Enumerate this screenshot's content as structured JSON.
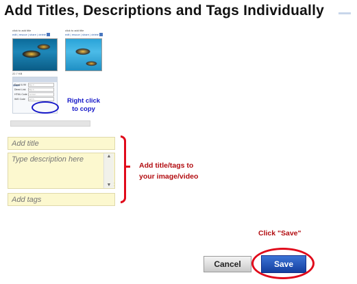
{
  "page": {
    "title": "Add Titles, Descriptions and Tags Individually"
  },
  "thumbnails": [
    {
      "caption": "click to add title",
      "link": "edit | rescue | share | delete"
    },
    {
      "caption": "click to add title",
      "link": "edit | rescue | share | delete"
    }
  ],
  "share_panel": {
    "header": "Share",
    "size": "22.7 KB",
    "rows": [
      {
        "label": "Email & IM",
        "value": "http://..."
      },
      {
        "label": "Direct Link",
        "value": "http://..."
      },
      {
        "label": "HTML Code",
        "value": "<a href..."
      },
      {
        "label": "IMG Code",
        "value": "[url=h..."
      }
    ]
  },
  "callouts": {
    "right_click_line1": "Right click",
    "right_click_line2": "to copy",
    "add_title_line1": "Add title/tags to",
    "add_title_line2": "your image/video",
    "click_save": "Click \"Save\""
  },
  "form": {
    "title_placeholder": "Add title",
    "description_placeholder": "Type description here",
    "tags_placeholder": "Add tags"
  },
  "buttons": {
    "cancel": "Cancel",
    "save": "Save"
  },
  "colors": {
    "annotation_red": "#e0091a",
    "annotation_blue": "#1416c8",
    "field_bg": "#fcf8cf",
    "save_blue": "#1d4fb5"
  }
}
